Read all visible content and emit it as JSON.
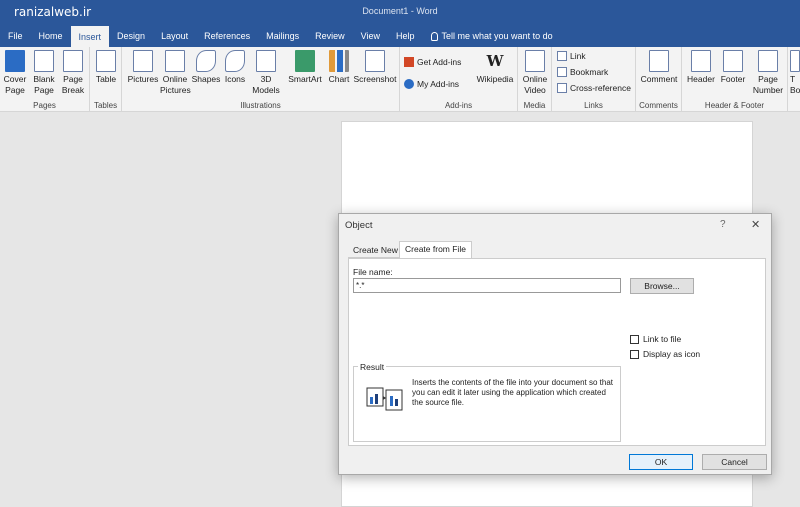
{
  "titlebar": {
    "watermark": "ranizalweb.ir",
    "document_title": "Document1  -  Word"
  },
  "tabs": [
    {
      "label": "File"
    },
    {
      "label": "Home"
    },
    {
      "label": "Insert"
    },
    {
      "label": "Design"
    },
    {
      "label": "Layout"
    },
    {
      "label": "References"
    },
    {
      "label": "Mailings"
    },
    {
      "label": "Review"
    },
    {
      "label": "View"
    },
    {
      "label": "Help"
    }
  ],
  "tell_me": "Tell me what you want to do",
  "ribbon": {
    "pages": {
      "label": "Pages",
      "cover": "Cover\nPage",
      "blank": "Blank\nPage",
      "break": "Page\nBreak"
    },
    "tables": {
      "label": "Tables",
      "table": "Table"
    },
    "illustrations": {
      "label": "Illustrations",
      "pictures": "Pictures",
      "online_pictures": "Online\nPictures",
      "shapes": "Shapes",
      "icons": "Icons",
      "models": "3D\nModels",
      "smartart": "SmartArt",
      "chart": "Chart",
      "screenshot": "Screenshot"
    },
    "addins": {
      "label": "Add-ins",
      "get": "Get Add-ins",
      "my": "My Add-ins",
      "wikipedia": "Wikipedia"
    },
    "media": {
      "label": "Media",
      "online_video": "Online\nVideo"
    },
    "links": {
      "label": "Links",
      "link": "Link",
      "bookmark": "Bookmark",
      "cross": "Cross-reference"
    },
    "comments": {
      "label": "Comments",
      "comment": "Comment"
    },
    "header_footer": {
      "label": "Header & Footer",
      "header": "Header",
      "footer": "Footer",
      "page_number": "Page\nNumber"
    },
    "text": {
      "t": "T",
      "b": "Bo"
    }
  },
  "dialog": {
    "title": "Object",
    "help": "?",
    "close": "✕",
    "tab_new": "Create New",
    "tab_file": "Create from File",
    "file_label": "File name:",
    "file_value": "*.*",
    "browse": "Browse...",
    "link_to_file": "Link to file",
    "display_as_icon": "Display as icon",
    "result_label": "Result",
    "result_text": "Inserts the contents of the file into your document so that you can edit it later using the application which created the source file.",
    "ok": "OK",
    "cancel": "Cancel"
  }
}
